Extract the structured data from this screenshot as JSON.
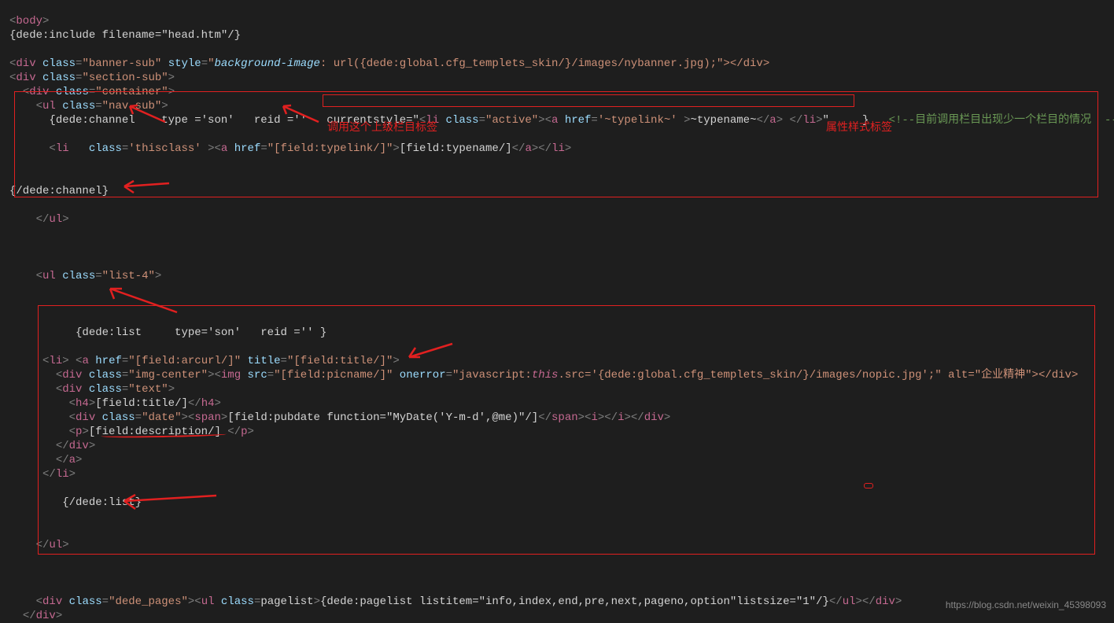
{
  "code": {
    "l1": "<body>",
    "l2": "{dede:include filename=\"head.htm\"/}",
    "l3": "",
    "l4a": "<div class=\"banner-sub\" style=\"",
    "l4b": "background-image",
    "l4c": ": url({dede:global.cfg_templets_skin/}/images/nybanner.jpg);\"></div>",
    "l5": "<div class=\"section-sub\">",
    "l6": "  <div class=\"container\">",
    "l7": "    <ul class=\"nav-sub\">",
    "l8a": "      {dede:channel    type ='son'   reid =''",
    "l8b": "currentstyle=\"<li class=\"active\"><a href='~typelink~' >~typename~</a> </li>\"",
    "l8c": "}",
    "l8d": "<!--目前调用栏目出现少一个栏目的情况  -->",
    "l9": "",
    "l10": "      <li   class='thisclass' ><a href=\"[field:typelink/]\">[field:typename/]</a></li>",
    "l11": "",
    "l12": "",
    "l13": "{/dede:channel}",
    "l14": "",
    "l15": "    </ul>",
    "l16": "",
    "l17": "",
    "l18": "",
    "l19": "    <ul class=\"list-4\">",
    "l20": "",
    "l21": "",
    "l22": "",
    "l23": "     {dede:list     type='son'   reid ='' }",
    "l24": "",
    "l25": "     <li> <a href=\"[field:arcurl/]\" title=\"[field:title/]\">",
    "l26a": "       <div class=\"img-center\"><img src=\"[field:picname/]\" onerror=\"javascript:",
    "l26b": "this",
    "l26c": ".src='{dede:global.cfg_templets_skin/}/images/nopic.jpg';\" alt=\"企业精神\"></div>",
    "l27": "       <div class=\"text\">",
    "l28": "         <h4>[field:title/]</h4>",
    "l29": "         <div class=\"date\"><span>[field:pubdate function=\"MyDate('Y-m-d',@me)\"/]</span><i></i></div>",
    "l30": "         <p>[field:description/] </p>",
    "l31": "       </div>",
    "l32": "       </a>",
    "l33": "     </li>",
    "l34": "",
    "l35": "    {/dede:list}",
    "l36": "",
    "l37": "",
    "l38": "    </ul>",
    "l39": "",
    "l40": "",
    "l41": "",
    "l42": "    <div class=\"dede_pages\"><ul class=pagelist>{dede:pagelist listitem=\"info,index,end,pre,next,pageno,option\"listsize=\"1\"/}</ul></div>",
    "l43": "  </div>"
  },
  "annotations": {
    "a1": "调用这个上级栏目标签",
    "a2": "属性样式标签"
  },
  "watermark": "https://blog.csdn.net/weixin_45398093"
}
